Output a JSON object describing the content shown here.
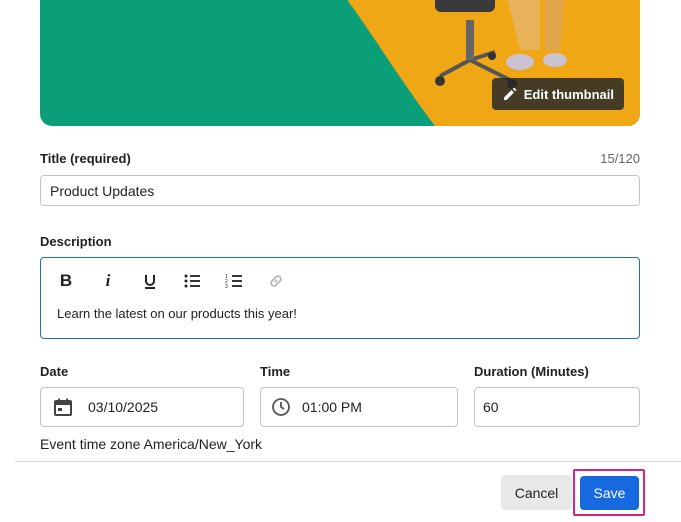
{
  "thumbnail": {
    "edit_label": "Edit thumbnail"
  },
  "title_field": {
    "label": "Title (required)",
    "counter": "15/120",
    "value": "Product Updates"
  },
  "description": {
    "label": "Description",
    "toolbar": [
      "bold",
      "italic",
      "underline",
      "bullet-list",
      "numbered-list",
      "link"
    ],
    "text": "Learn the latest on our products this year!"
  },
  "date": {
    "label": "Date",
    "value": "03/10/2025"
  },
  "time": {
    "label": "Time",
    "value": "01:00 PM"
  },
  "duration": {
    "label": "Duration (Minutes)",
    "value": "60"
  },
  "timezone": "Event time zone America/New_York",
  "actions": {
    "cancel": "Cancel",
    "save": "Save"
  },
  "colors": {
    "accent": "#1769e0",
    "thumb_green": "#0a9f78",
    "thumb_yellow": "#f0a716",
    "highlight": "#d6257c"
  }
}
